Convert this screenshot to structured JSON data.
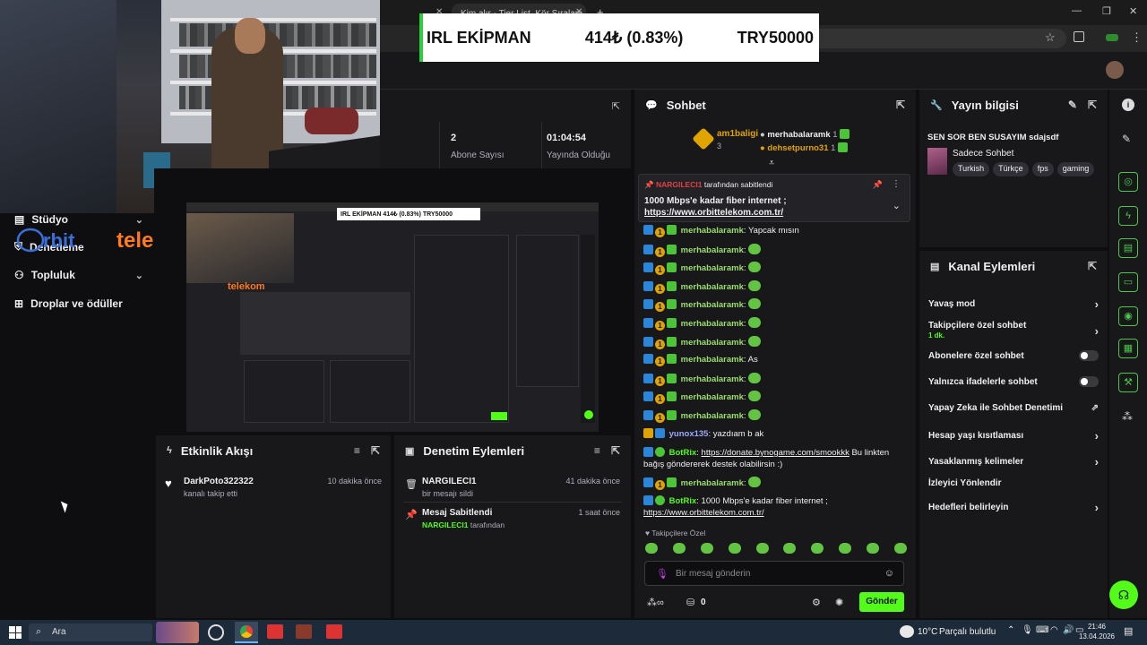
{
  "browser": {
    "tab_title": "Kim alır - Tier List, Kör Sıralam..."
  },
  "ticker": {
    "label": "IRL EKİPMAN",
    "value": "414₺ (0.83%)",
    "goal": "TRY50000"
  },
  "overlay": {
    "sponsor_logo": "orbittelekom",
    "sponsor_text": "telekom"
  },
  "left_nav": {
    "items": [
      {
        "label": "Stüdyo",
        "icon": "studio-icon",
        "has_chevron": true
      },
      {
        "label": "Denetleme",
        "icon": "shield-icon",
        "has_chevron": false
      },
      {
        "label": "Topluluk",
        "icon": "people-icon",
        "has_chevron": true
      },
      {
        "label": "Droplar ve ödüller",
        "icon": "gift-icon",
        "has_chevron": false
      }
    ]
  },
  "stats": {
    "subscribers_value": "2",
    "subscribers_label": "Abone Sayısı",
    "uptime_value": "01:04:54",
    "uptime_label": "Yayında Olduğu Süre"
  },
  "activity_feed": {
    "title": "Etkinlik Akışı",
    "items": [
      {
        "user": "DarkPoto322322",
        "action": "kanalı takip etti",
        "time": "10 dakika önce"
      }
    ]
  },
  "mod_actions": {
    "title": "Denetim Eylemleri",
    "items": [
      {
        "user": "NARGILECI1",
        "action": "bir mesajı sildi",
        "time": "41 dakika önce"
      },
      {
        "title": "Mesaj Sabitlendi",
        "by": "NARGILECI1",
        "by_suffix": "tarafından",
        "time": "1 saat önce"
      }
    ]
  },
  "chat": {
    "title": "Sohbet",
    "leaderboard": {
      "top_name": "am1baligi",
      "top_count": "3",
      "others": [
        {
          "name": "merhabalaramk",
          "count": "1"
        },
        {
          "name": "dehsetpurno31",
          "count": "1"
        }
      ]
    },
    "pinned": {
      "by": "NARGILECI1",
      "by_suffix": "tarafından sabitlendi",
      "text": "1000 Mbps'e kadar fiber internet ;",
      "link": "https://www.orbittelekom.com.tr/"
    },
    "messages": [
      {
        "user": "merhabalaramk",
        "text": "Yapcak mısın",
        "emote": false
      },
      {
        "user": "merhabalaramk",
        "text": "",
        "emote": true
      },
      {
        "user": "merhabalaramk",
        "text": "",
        "emote": true
      },
      {
        "user": "merhabalaramk",
        "text": "",
        "emote": true
      },
      {
        "user": "merhabalaramk",
        "text": "",
        "emote": true
      },
      {
        "user": "merhabalaramk",
        "text": "",
        "emote": true
      },
      {
        "user": "merhabalaramk",
        "text": "",
        "emote": true
      },
      {
        "user": "merhabalaramk",
        "text": "As",
        "emote": false
      },
      {
        "user": "merhabalaramk",
        "text": "",
        "emote": true
      },
      {
        "user": "merhabalaramk",
        "text": "",
        "emote": true
      },
      {
        "user": "merhabalaramk",
        "text": "",
        "emote": true
      },
      {
        "user": "yunox135",
        "text": "yazdıam b ak",
        "emote": false
      }
    ],
    "bot_message_1": {
      "user": "BotRix",
      "link": "https://donate.bynogame.com/smookkk",
      "text": "Bu linkten bağış göndererek destek olabilirsin :)"
    },
    "last_user_message": {
      "user": "merhabalaramk"
    },
    "bot_message_2": {
      "user": "BotRix",
      "text": "1000 Mbps'e kadar fiber internet ;",
      "link": "https://www.orbittelekom.com.tr/"
    },
    "followers_only_label": "Takipçilere Özel",
    "input_placeholder": "Bir mesaj gönderin",
    "points_value": "0",
    "send_label": "Gönder"
  },
  "stream_info": {
    "title_label": "Yayın bilgisi",
    "stream_title": "SEN SOR BEN SUSAYIM sdajsdf",
    "category": "Sadece Sohbet",
    "tags": [
      "Turkish",
      "Türkçe",
      "fps",
      "gaming"
    ]
  },
  "channel_actions": {
    "title": "Kanal Eylemleri",
    "rows": [
      {
        "label": "Yavaş mod",
        "type": "chevron"
      },
      {
        "label": "Takipçilere özel sohbet",
        "sub": "1 dk.",
        "type": "chevron"
      },
      {
        "label": "Abonelere özel sohbet",
        "type": "toggle"
      },
      {
        "label": "Yalnızca ifadelerle sohbet",
        "type": "toggle"
      },
      {
        "label": "Yapay Zeka ile Sohbet Denetimi",
        "type": "external"
      },
      {
        "label": "Hesap yaşı kısıtlaması",
        "type": "chevron"
      },
      {
        "label": "Yasaklanmış kelimeler",
        "type": "chevron"
      },
      {
        "label": "İzleyici Yönlendir",
        "type": "none"
      },
      {
        "label": "Hedefleri belirleyin",
        "type": "chevron"
      }
    ]
  },
  "taskbar": {
    "search_label": "Ara",
    "weather": "10°C",
    "weather_desc": "Parçalı bulutlu",
    "time": "21:46",
    "date": "13.04.2026"
  },
  "colors": {
    "accent": "#53fc18",
    "panel": "#18181b",
    "bg": "#0e0e10"
  }
}
